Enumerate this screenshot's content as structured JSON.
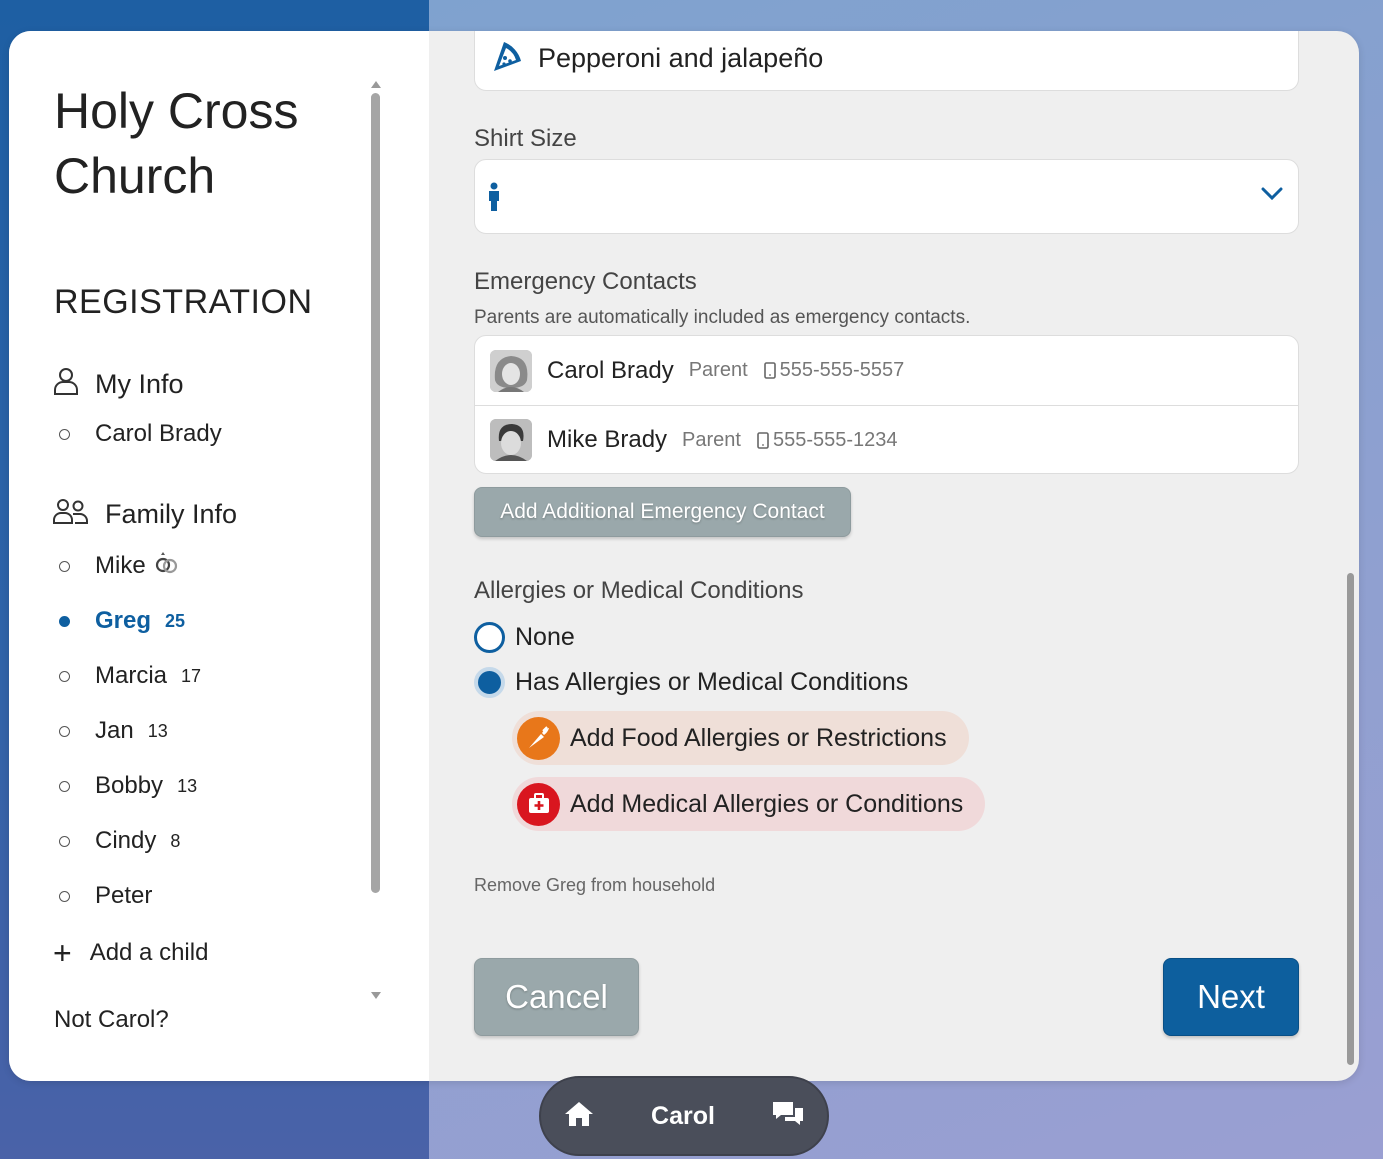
{
  "sidebar": {
    "church_name": "Holy Cross Church",
    "section_title": "REGISTRATION",
    "my_info_label": "My Info",
    "my_info_items": [
      {
        "name": "Carol Brady"
      }
    ],
    "family_info_label": "Family Info",
    "family_items": [
      {
        "name": "Mike",
        "age": "",
        "badge": "rings-icon"
      },
      {
        "name": "Greg",
        "age": "25",
        "active": true
      },
      {
        "name": "Marcia",
        "age": "17"
      },
      {
        "name": "Jan",
        "age": "13"
      },
      {
        "name": "Bobby",
        "age": "13"
      },
      {
        "name": "Cindy",
        "age": "8"
      },
      {
        "name": "Peter",
        "age": ""
      }
    ],
    "add_child_label": "Add a child",
    "not_user_label": "Not Carol?"
  },
  "form": {
    "pizza_value": "Pepperoni and jalapeño",
    "shirt_size_label": "Shirt Size",
    "shirt_size_value": "",
    "emergency_label": "Emergency Contacts",
    "emergency_sub": "Parents are automatically included as emergency contacts.",
    "contacts": [
      {
        "name": "Carol Brady",
        "role": "Parent",
        "phone": "555-555-5557"
      },
      {
        "name": "Mike Brady",
        "role": "Parent",
        "phone": "555-555-1234"
      }
    ],
    "add_contact_label": "Add Additional Emergency Contact",
    "allergies_label": "Allergies or Medical Conditions",
    "option_none": "None",
    "option_has": "Has Allergies or Medical Conditions",
    "add_food_label": "Add Food Allergies or Restrictions",
    "add_medical_label": "Add Medical Allergies or Conditions",
    "remove_label": "Remove Greg from household",
    "cancel_label": "Cancel",
    "next_label": "Next"
  },
  "bottom_bar": {
    "user_name": "Carol"
  },
  "colors": {
    "accent": "#0e5fa0",
    "food": "#e8771a",
    "medical": "#d9161f",
    "grey_button": "#9aa8ab"
  }
}
